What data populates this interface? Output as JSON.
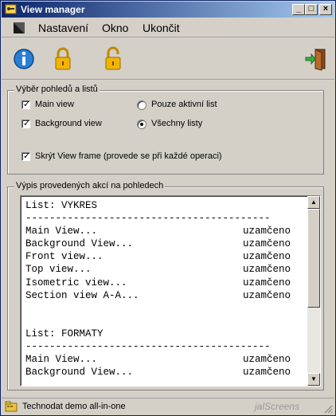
{
  "window": {
    "title": "View manager"
  },
  "caption_buttons": {
    "minimize": "_",
    "maximize": "□",
    "close": "×"
  },
  "menu": {
    "items": [
      "Nastavení",
      "Okno",
      "Ukončit"
    ]
  },
  "toolbar": {
    "icons": [
      "info-icon",
      "lock-icon",
      "unlock-icon",
      "exit-door-icon"
    ]
  },
  "view_group": {
    "legend": "Výběr pohledů a listů",
    "main_view": {
      "label": "Main view",
      "checked": true
    },
    "background_view": {
      "label": "Background view",
      "checked": true
    },
    "active_sheet_only": {
      "label": "Pouze aktivní list",
      "selected": false
    },
    "all_sheets": {
      "label": "Všechny listy",
      "selected": true
    },
    "hide_view_frame": {
      "label": "Skrýt View frame (provede se při každé operaci)",
      "checked": true
    }
  },
  "log_group": {
    "legend": "Výpis provedených akcí na pohledech",
    "lines": [
      {
        "name": "List: VYKRES",
        "status": ""
      },
      {
        "name": "-----------------------------------------",
        "status": ""
      },
      {
        "name": "Main View...",
        "status": "uzamčeno"
      },
      {
        "name": "Background View...",
        "status": "uzamčeno"
      },
      {
        "name": "Front view...",
        "status": "uzamčeno"
      },
      {
        "name": "Top view...",
        "status": "uzamčeno"
      },
      {
        "name": "Isometric view...",
        "status": "uzamčeno"
      },
      {
        "name": "Section view A-A...",
        "status": "uzamčeno"
      },
      {
        "name": "",
        "status": ""
      },
      {
        "name": "",
        "status": ""
      },
      {
        "name": "List: FORMATY",
        "status": ""
      },
      {
        "name": "-----------------------------------------",
        "status": ""
      },
      {
        "name": "Main View...",
        "status": "uzamčeno"
      },
      {
        "name": "Background View...",
        "status": "uzamčeno"
      }
    ]
  },
  "status": {
    "text": "Technodat demo all-in-one",
    "watermark": "jalScreens"
  },
  "colors": {
    "title_start": "#0a246a",
    "title_end": "#a6caf0",
    "face": "#d4d0c8"
  }
}
